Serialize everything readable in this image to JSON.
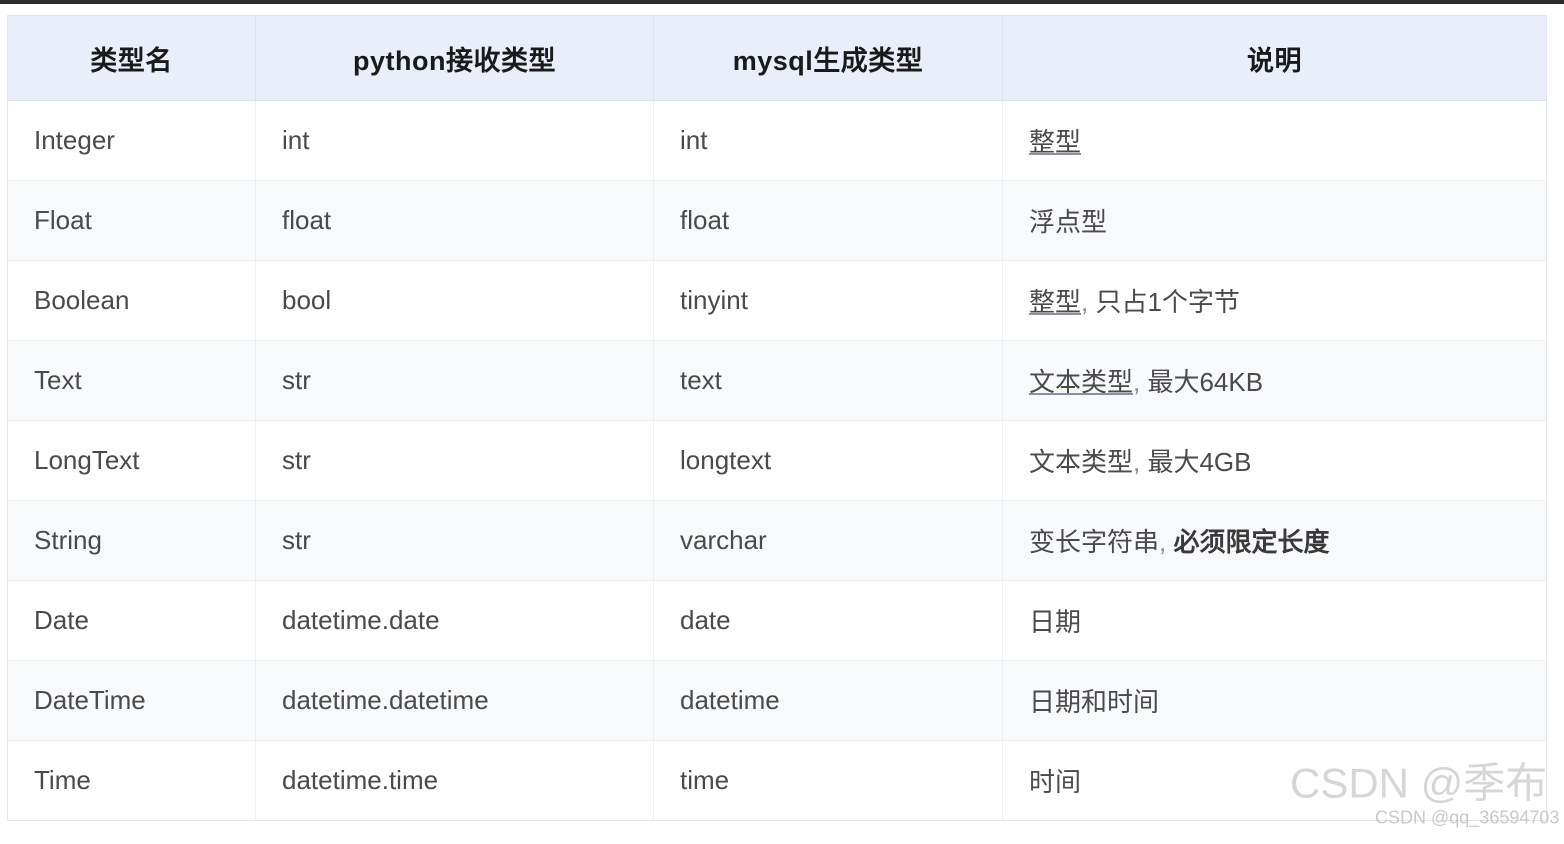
{
  "table": {
    "headers": [
      {
        "label": "类型名"
      },
      {
        "label": "python接收类型"
      },
      {
        "label": "mysql生成类型"
      },
      {
        "label": "说明"
      }
    ],
    "rows": [
      {
        "type_name": "Integer",
        "python_type": "int",
        "mysql_type": "int",
        "description": "整型",
        "desc_parts": {
          "lead": "整型",
          "lead_style": "underline",
          "sep": "",
          "tail": "",
          "tail_style": ""
        }
      },
      {
        "type_name": "Float",
        "python_type": "float",
        "mysql_type": "float",
        "description": "浮点型",
        "desc_parts": {
          "lead": "浮点型",
          "lead_style": "none",
          "sep": "",
          "tail": "",
          "tail_style": ""
        }
      },
      {
        "type_name": "Boolean",
        "python_type": "bool",
        "mysql_type": "tinyint",
        "description": "整型, 只占1个字节",
        "desc_parts": {
          "lead": "整型",
          "lead_style": "underline",
          "sep": ", ",
          "tail": "只占1个字节",
          "tail_style": "none"
        }
      },
      {
        "type_name": "Text",
        "python_type": "str",
        "mysql_type": "text",
        "description": "文本类型, 最大64KB",
        "desc_parts": {
          "lead": "文本类型",
          "lead_style": "underline",
          "sep": ", ",
          "tail": "最大64KB",
          "tail_style": "none"
        }
      },
      {
        "type_name": "LongText",
        "python_type": "str",
        "mysql_type": "longtext",
        "description": "文本类型, 最大4GB",
        "desc_parts": {
          "lead": "文本类型",
          "lead_style": "none",
          "sep": ", ",
          "tail": "最大4GB",
          "tail_style": "none"
        }
      },
      {
        "type_name": "String",
        "python_type": "str",
        "mysql_type": "varchar",
        "description": "变长字符串, 必须限定长度",
        "desc_parts": {
          "lead": "变长字符串",
          "lead_style": "none",
          "sep": ", ",
          "tail": "必须限定长度",
          "tail_style": "bold"
        }
      },
      {
        "type_name": "Date",
        "python_type": "datetime.date",
        "mysql_type": "date",
        "description": "日期",
        "desc_parts": {
          "lead": "日期",
          "lead_style": "none",
          "sep": "",
          "tail": "",
          "tail_style": ""
        }
      },
      {
        "type_name": "DateTime",
        "python_type": "datetime.datetime",
        "mysql_type": "datetime",
        "description": "日期和时间",
        "desc_parts": {
          "lead": "日期和时间",
          "lead_style": "none",
          "sep": "",
          "tail": "",
          "tail_style": ""
        }
      },
      {
        "type_name": "Time",
        "python_type": "datetime.time",
        "mysql_type": "time",
        "description": "时间",
        "desc_parts": {
          "lead": "时间",
          "lead_style": "none",
          "sep": "",
          "tail": "",
          "tail_style": ""
        }
      }
    ]
  },
  "watermarks": {
    "main": "CSDN @季布",
    "sub": "CSDN @qq_36594703"
  },
  "colors": {
    "header_background": "#eaeef8",
    "header_text": "#1a1a1a",
    "row_alt_background": "#f8f9fa",
    "row_background": "#ffffff",
    "cell_text": "#4a4a4a",
    "border": "#eceef1",
    "watermark": "#c9c9c9"
  }
}
